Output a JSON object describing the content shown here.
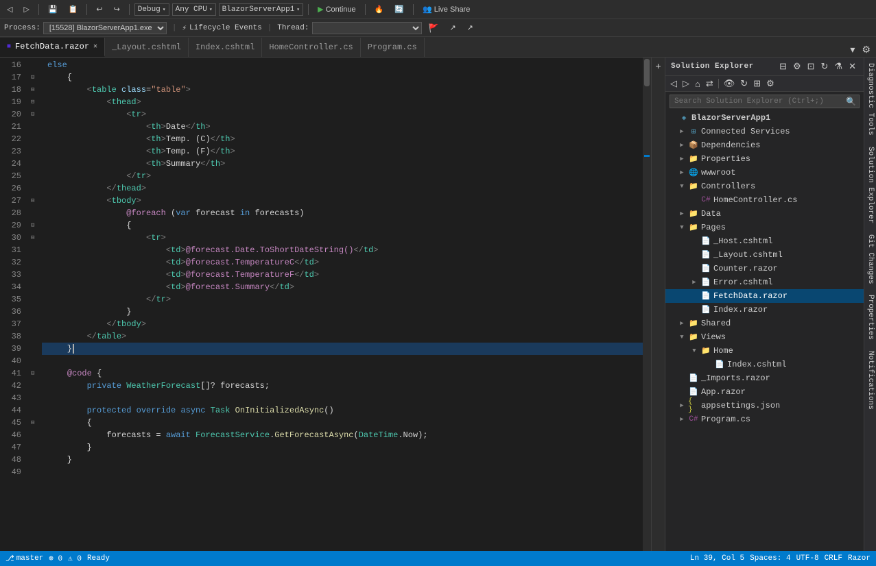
{
  "toolbar": {
    "menus": [
      "🔄",
      "Debug",
      "Any CPU",
      "BlazorServerApp1",
      "▶ Continue",
      "🔥",
      "🔄",
      "Live Share"
    ],
    "debug_label": "Debug",
    "cpu_label": "Any CPU",
    "app_label": "BlazorServerApp1",
    "continue_label": "▶ Continue",
    "live_share_label": "Live Share"
  },
  "toolbar2": {
    "process_label": "Process:",
    "process_value": "[15528] BlazorServerApp1.exe",
    "lifecycle_label": "Lifecycle Events",
    "thread_label": "Thread:"
  },
  "tabs": [
    {
      "label": "FetchData.razor",
      "active": true,
      "modified": false,
      "closeable": true
    },
    {
      "label": "_Layout.cshtml",
      "active": false,
      "closeable": false
    },
    {
      "label": "Index.cshtml",
      "active": false,
      "closeable": false
    },
    {
      "label": "HomeController.cs",
      "active": false,
      "closeable": false
    },
    {
      "label": "Program.cs",
      "active": false,
      "closeable": false
    }
  ],
  "code_lines": [
    {
      "num": 16,
      "content": "    else",
      "indent": 1,
      "type": "kw"
    },
    {
      "num": 17,
      "content": "    {",
      "indent": 1,
      "collapsible": true
    },
    {
      "num": 18,
      "content": "        <table class=\"table\">",
      "indent": 2,
      "collapsible": true
    },
    {
      "num": 19,
      "content": "            <thead>",
      "indent": 3,
      "collapsible": true
    },
    {
      "num": 20,
      "content": "                <tr>",
      "indent": 4,
      "collapsible": true
    },
    {
      "num": 21,
      "content": "                    <th>Date</th>",
      "indent": 5
    },
    {
      "num": 22,
      "content": "                    <th>Temp. (C)</th>",
      "indent": 5
    },
    {
      "num": 23,
      "content": "                    <th>Temp. (F)</th>",
      "indent": 5
    },
    {
      "num": 24,
      "content": "                    <th>Summary</th>",
      "indent": 5
    },
    {
      "num": 25,
      "content": "                </tr>",
      "indent": 4
    },
    {
      "num": 26,
      "content": "            </thead>",
      "indent": 3
    },
    {
      "num": 27,
      "content": "            <tbody>",
      "indent": 3,
      "collapsible": true
    },
    {
      "num": 28,
      "content": "                @foreach (var forecast in forecasts)",
      "indent": 4
    },
    {
      "num": 29,
      "content": "                {",
      "indent": 4,
      "collapsible": true
    },
    {
      "num": 30,
      "content": "                    <tr>",
      "indent": 5,
      "collapsible": true
    },
    {
      "num": 31,
      "content": "                        <td>@forecast.Date.ToShortDateString()</td>",
      "indent": 6
    },
    {
      "num": 32,
      "content": "                        <td>@forecast.TemperatureC</td>",
      "indent": 6
    },
    {
      "num": 33,
      "content": "                        <td>@forecast.TemperatureF</td>",
      "indent": 6
    },
    {
      "num": 34,
      "content": "                        <td>@forecast.Summary</td>",
      "indent": 6
    },
    {
      "num": 35,
      "content": "                    </tr>",
      "indent": 5
    },
    {
      "num": 36,
      "content": "                }",
      "indent": 4
    },
    {
      "num": 37,
      "content": "            </tbody>",
      "indent": 3
    },
    {
      "num": 38,
      "content": "        </table>",
      "indent": 2
    },
    {
      "num": 39,
      "content": "    }",
      "indent": 1,
      "highlighted": true
    },
    {
      "num": 40,
      "content": ""
    },
    {
      "num": 41,
      "content": "    @code {",
      "indent": 1,
      "collapsible": true
    },
    {
      "num": 42,
      "content": "        private WeatherForecast[]? forecasts;",
      "indent": 2
    },
    {
      "num": 43,
      "content": ""
    },
    {
      "num": 44,
      "content": "        protected override async Task OnInitializedAsync()",
      "indent": 2
    },
    {
      "num": 45,
      "content": "        {",
      "indent": 2,
      "collapsible": true
    },
    {
      "num": 46,
      "content": "            forecasts = await ForecastService.GetForecastAsync(DateTime.Now);",
      "indent": 3
    },
    {
      "num": 47,
      "content": "        }",
      "indent": 2
    },
    {
      "num": 48,
      "content": "    }",
      "indent": 1
    },
    {
      "num": 49,
      "content": ""
    }
  ],
  "solution_explorer": {
    "title": "Solution Explorer",
    "search_placeholder": "Search Solution Explorer (Ctrl+;)",
    "root": {
      "name": "BlazorServerApp1",
      "type": "project",
      "children": [
        {
          "name": "Connected Services",
          "type": "folder",
          "expanded": false,
          "indent": 1
        },
        {
          "name": "Dependencies",
          "type": "folder",
          "expanded": false,
          "indent": 1
        },
        {
          "name": "Properties",
          "type": "folder",
          "expanded": false,
          "indent": 1
        },
        {
          "name": "wwwroot",
          "type": "folder",
          "expanded": false,
          "indent": 1
        },
        {
          "name": "Controllers",
          "type": "folder",
          "expanded": true,
          "indent": 1
        },
        {
          "name": "HomeController.cs",
          "type": "cs",
          "expanded": false,
          "indent": 2
        },
        {
          "name": "Data",
          "type": "folder",
          "expanded": false,
          "indent": 1
        },
        {
          "name": "Pages",
          "type": "folder",
          "expanded": true,
          "indent": 1
        },
        {
          "name": "_Host.cshtml",
          "type": "cshtml",
          "indent": 2
        },
        {
          "name": "_Layout.cshtml",
          "type": "cshtml",
          "indent": 2
        },
        {
          "name": "Counter.razor",
          "type": "razor",
          "indent": 2
        },
        {
          "name": "Error.cshtml",
          "type": "cshtml",
          "indent": 2,
          "expanded": false
        },
        {
          "name": "FetchData.razor",
          "type": "razor",
          "indent": 2,
          "active": true
        },
        {
          "name": "Index.razor",
          "type": "razor",
          "indent": 2
        },
        {
          "name": "Shared",
          "type": "folder",
          "expanded": false,
          "indent": 1
        },
        {
          "name": "Views",
          "type": "folder",
          "expanded": true,
          "indent": 1
        },
        {
          "name": "Home",
          "type": "folder",
          "expanded": true,
          "indent": 2
        },
        {
          "name": "Index.cshtml",
          "type": "cshtml",
          "indent": 3
        },
        {
          "name": "_Imports.razor",
          "type": "razor",
          "indent": 1
        },
        {
          "name": "App.razor",
          "type": "razor",
          "indent": 1
        },
        {
          "name": "appsettings.json",
          "type": "json",
          "expanded": false,
          "indent": 1
        },
        {
          "name": "Program.cs",
          "type": "cs",
          "indent": 1
        }
      ]
    }
  },
  "right_panels": [
    "Diagnostic Tools",
    "Solution Explorer",
    "Git Changes",
    "Properties",
    "Notifications"
  ],
  "status_bar": {
    "items": [
      "⚡",
      "Process: [15528] BlazorServerApp1.exe",
      "Ready"
    ]
  }
}
